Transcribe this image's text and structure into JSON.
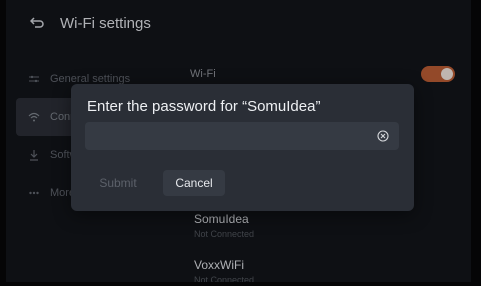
{
  "header": {
    "title": "Wi-Fi settings"
  },
  "sidebar": {
    "items": [
      {
        "label": "General settings"
      },
      {
        "label": "Conn"
      },
      {
        "label": "Softw"
      },
      {
        "label": "More"
      }
    ]
  },
  "content": {
    "wifi_label": "Wi-Fi",
    "wifi_enabled": true,
    "networks": [
      {
        "name": "SomuIdea",
        "status": "Not Connected"
      },
      {
        "name": "VoxxWiFi",
        "status": "Not Connected"
      }
    ]
  },
  "dialog": {
    "title": "Enter the password for “SomuIdea”",
    "password_value": "",
    "submit_label": "Submit",
    "cancel_label": "Cancel"
  },
  "colors": {
    "accent": "#b45a32",
    "dialog_bg": "#2a2e36"
  }
}
